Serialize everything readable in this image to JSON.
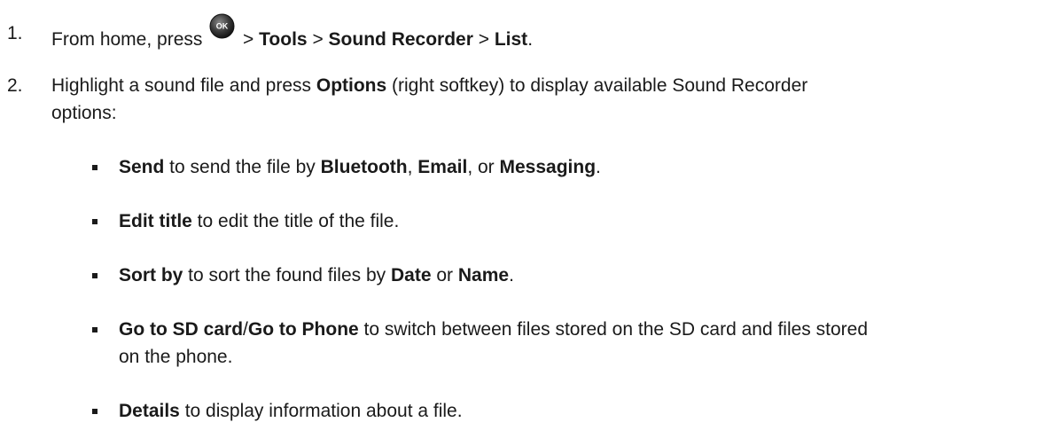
{
  "steps": [
    {
      "number": "1.",
      "pre": "From home, press ",
      "icon": "ok-button-icon",
      "sep1": " > ",
      "b1": "Tools",
      "sep2": " > ",
      "b2": "Sound Recorder",
      "sep3": " > ",
      "b3": "List",
      "end": "."
    },
    {
      "number": "2.",
      "l1_pre": "Highlight a sound file and press ",
      "l1_bold": "Options",
      "l1_post": " (right softkey) to display available Sound Recorder",
      "l2": "options:"
    }
  ],
  "options": [
    {
      "b1": "Send",
      "t1": " to send the file by ",
      "b2": "Bluetooth",
      "t2": ", ",
      "b3": "Email",
      "t3": ", or ",
      "b4": "Messaging",
      "t4": "."
    },
    {
      "b1": "Edit title",
      "t1": " to edit the title of the file."
    },
    {
      "b1": "Sort by",
      "t1": " to sort the found files by ",
      "b2": "Date",
      "t2": " or ",
      "b3": "Name",
      "t3": "."
    },
    {
      "b1": "Go to SD card",
      "t1": "/",
      "b2": "Go to Phone",
      "t2": " to switch between files stored on the SD card and files stored",
      "l2": "on the phone."
    },
    {
      "b1": "Details",
      "t1": " to display information about a file."
    }
  ],
  "icon_label": "OK"
}
